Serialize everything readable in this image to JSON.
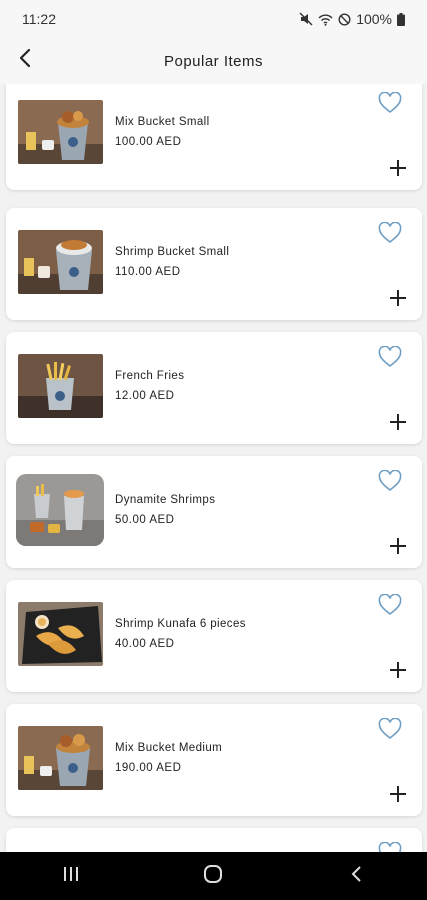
{
  "status_bar": {
    "time": "11:22",
    "battery": "100%"
  },
  "header": {
    "title": "Popular Items"
  },
  "items": [
    {
      "name": "Mix Bucket Small",
      "price": "100.00 AED"
    },
    {
      "name": "Shrimp Bucket Small",
      "price": "110.00 AED"
    },
    {
      "name": "French Fries",
      "price": "12.00 AED"
    },
    {
      "name": "Dynamite Shrimps",
      "price": "50.00 AED"
    },
    {
      "name": "Shrimp Kunafa 6 pieces",
      "price": "40.00 AED"
    },
    {
      "name": "Mix Bucket Medium",
      "price": "190.00 AED"
    }
  ],
  "colors": {
    "accent": "#6f9ec4",
    "background": "#f2f2f2",
    "nav": "#000000"
  },
  "icons": {
    "back": "chevron-left-icon",
    "favorite": "heart-outline-icon",
    "add": "plus-icon",
    "nav_recents": "recents-icon",
    "nav_home": "home-icon",
    "nav_back": "back-icon"
  }
}
